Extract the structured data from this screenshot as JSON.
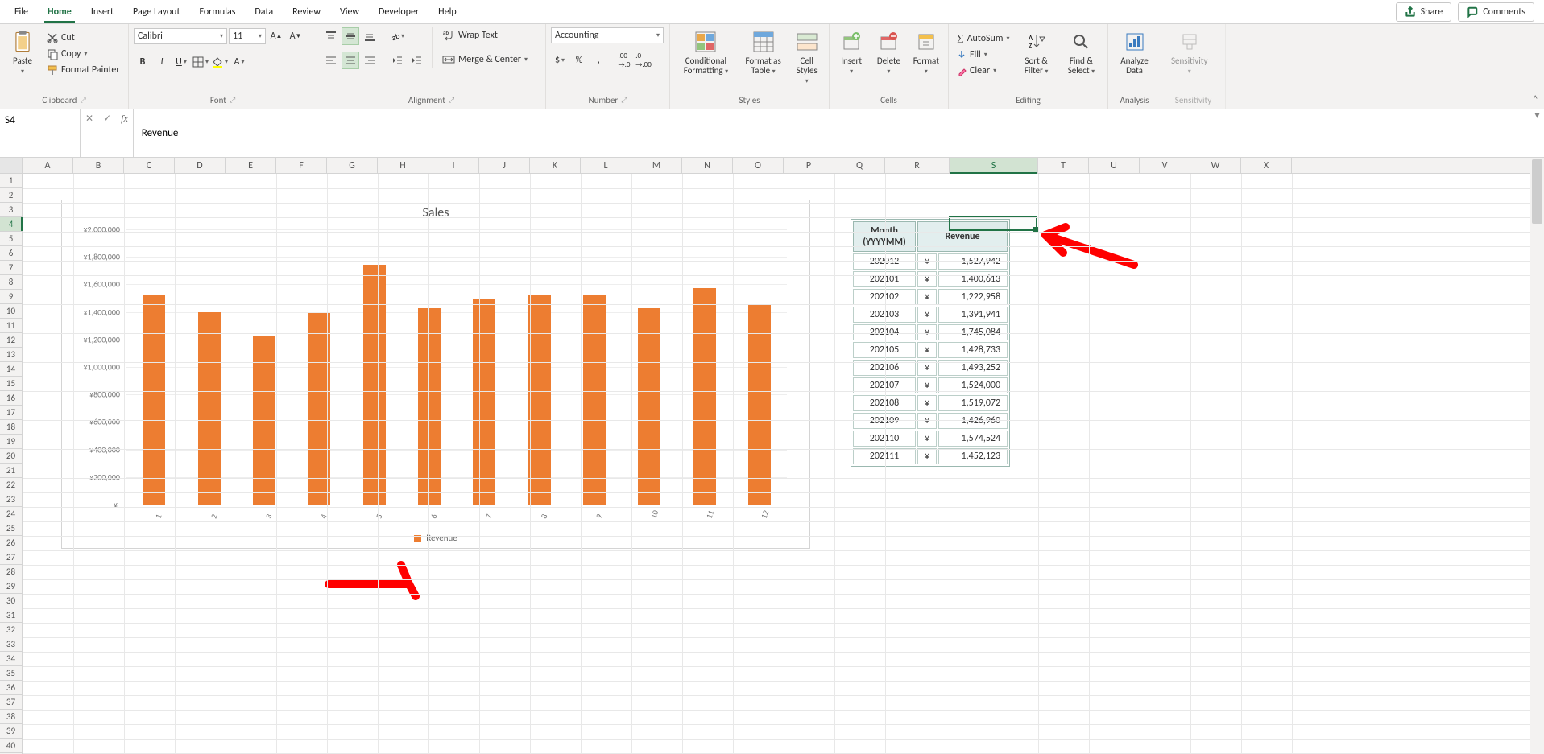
{
  "tabs": {
    "items": [
      "File",
      "Home",
      "Insert",
      "Page Layout",
      "Formulas",
      "Data",
      "Review",
      "View",
      "Developer",
      "Help"
    ],
    "active": 1
  },
  "share": {
    "label": "Share"
  },
  "comments": {
    "label": "Comments"
  },
  "ribbon": {
    "clipboard": {
      "paste": "Paste",
      "cut": "Cut",
      "copy": "Copy",
      "format_painter": "Format Painter",
      "title": "Clipboard"
    },
    "font": {
      "name": "Calibri",
      "size": "11",
      "title": "Font"
    },
    "alignment": {
      "wrap": "Wrap Text",
      "merge": "Merge & Center",
      "title": "Alignment"
    },
    "number": {
      "format": "Accounting",
      "title": "Number"
    },
    "styles": {
      "cond": "Conditional Formatting",
      "fat": "Format as Table",
      "cell": "Cell Styles",
      "title": "Styles"
    },
    "cells": {
      "insert": "Insert",
      "delete": "Delete",
      "format": "Format",
      "title": "Cells"
    },
    "editing": {
      "autosum": "AutoSum",
      "fill": "Fill",
      "clear": "Clear",
      "sort": "Sort & Filter",
      "find": "Find & Select",
      "title": "Editing"
    },
    "analysis": {
      "btn": "Analyze Data",
      "title": "Analysis"
    },
    "sensitivity": {
      "btn": "Sensitivity",
      "title": "Sensitivity"
    }
  },
  "formula_bar": {
    "name_box": "S4",
    "formula": "Revenue"
  },
  "columns": [
    "A",
    "B",
    "C",
    "D",
    "E",
    "F",
    "G",
    "H",
    "I",
    "J",
    "K",
    "L",
    "M",
    "N",
    "O",
    "P",
    "Q",
    "R",
    "S",
    "T",
    "U",
    "V",
    "W",
    "X"
  ],
  "col_widths": {
    "default": 63,
    "R": 80,
    "S": 110
  },
  "selected": {
    "col": "S",
    "row": 4
  },
  "data_table": {
    "headers": [
      "Month (YYYYMM)",
      "Revenue"
    ],
    "currency": "¥",
    "rows": [
      {
        "m": "202012",
        "v": "1,527,942"
      },
      {
        "m": "202101",
        "v": "1,400,613"
      },
      {
        "m": "202102",
        "v": "1,222,958"
      },
      {
        "m": "202103",
        "v": "1,391,941"
      },
      {
        "m": "202104",
        "v": "1,745,084"
      },
      {
        "m": "202105",
        "v": "1,428,733"
      },
      {
        "m": "202106",
        "v": "1,493,252"
      },
      {
        "m": "202107",
        "v": "1,524,000"
      },
      {
        "m": "202108",
        "v": "1,519,072"
      },
      {
        "m": "202109",
        "v": "1,426,960"
      },
      {
        "m": "202110",
        "v": "1,574,524"
      },
      {
        "m": "202111",
        "v": "1,452,123"
      }
    ]
  },
  "chart_data": {
    "type": "bar",
    "title": "Sales",
    "series_name": "Revenue",
    "ylabel": "",
    "ylim": [
      0,
      2000000
    ],
    "ytick_step": 200000,
    "yticks": [
      "¥-",
      "¥200,000",
      "¥400,000",
      "¥600,000",
      "¥800,000",
      "¥1,000,000",
      "¥1,200,000",
      "¥1,400,000",
      "¥1,600,000",
      "¥1,800,000",
      "¥2,000,000"
    ],
    "categories": [
      "1",
      "2",
      "3",
      "4",
      "5",
      "6",
      "7",
      "8",
      "9",
      "10",
      "11",
      "12"
    ],
    "values": [
      1527942,
      1400613,
      1222958,
      1391941,
      1745084,
      1428733,
      1493252,
      1524000,
      1519072,
      1426960,
      1574524,
      1452123
    ]
  }
}
